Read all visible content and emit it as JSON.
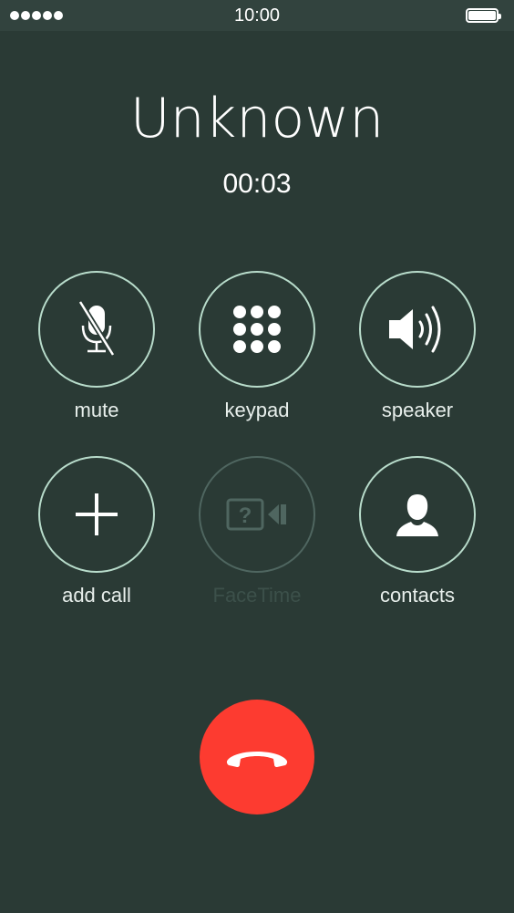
{
  "status_bar": {
    "signal_dots": 5,
    "time": "10:00",
    "battery_level": 1.0
  },
  "call": {
    "caller_name": "Unknown",
    "duration": "00:03"
  },
  "controls": [
    {
      "label": "mute",
      "icon": "mic-off-icon",
      "enabled": true
    },
    {
      "label": "keypad",
      "icon": "keypad-icon",
      "enabled": true
    },
    {
      "label": "speaker",
      "icon": "speaker-icon",
      "enabled": true
    },
    {
      "label": "add call",
      "icon": "plus-icon",
      "enabled": true
    },
    {
      "label": "FaceTime",
      "icon": "facetime-icon",
      "enabled": false
    },
    {
      "label": "contacts",
      "icon": "contact-icon",
      "enabled": true
    }
  ],
  "end_call": {
    "icon": "phone-hangup-icon",
    "color": "#fd3b30"
  },
  "colors": {
    "background": "#2a3a35",
    "status_bar": "#32433e",
    "ring": "#b8dccb",
    "disabled": "#4f6660"
  }
}
